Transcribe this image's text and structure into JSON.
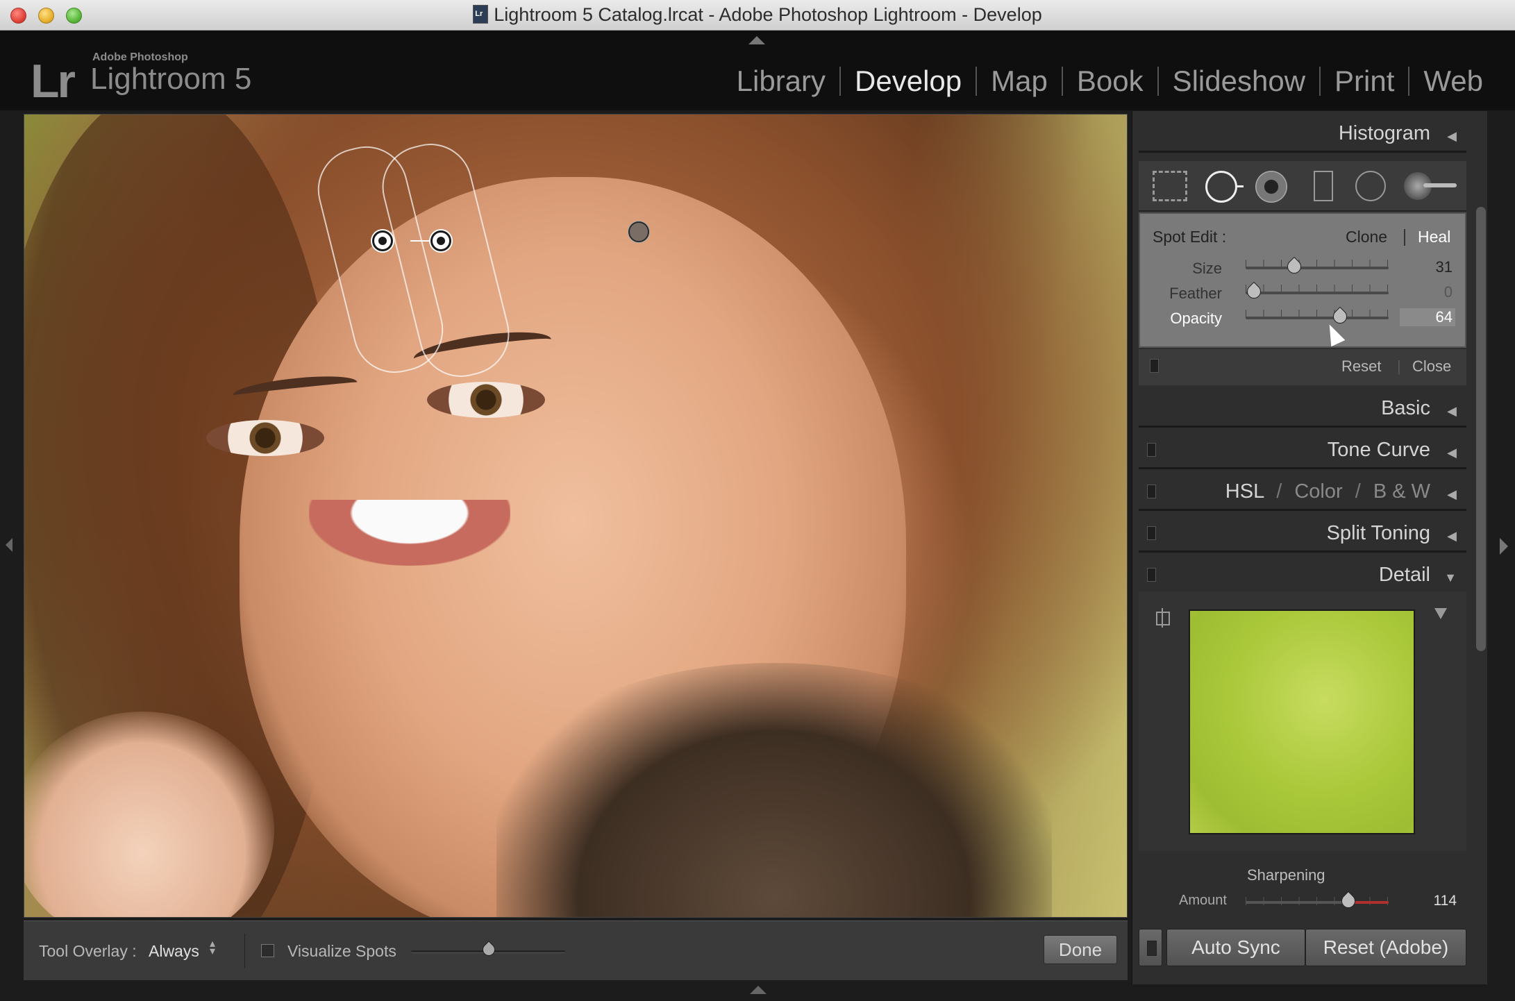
{
  "window": {
    "title": "Lightroom 5 Catalog.lrcat - Adobe Photoshop Lightroom - Develop"
  },
  "brand": {
    "logo": "Lr",
    "small": "Adobe Photoshop",
    "big": "Lightroom 5"
  },
  "modules": [
    {
      "label": "Library"
    },
    {
      "label": "Develop",
      "active": true
    },
    {
      "label": "Map"
    },
    {
      "label": "Book"
    },
    {
      "label": "Slideshow"
    },
    {
      "label": "Print"
    },
    {
      "label": "Web"
    }
  ],
  "toolbar": {
    "overlay_label": "Tool Overlay :",
    "overlay_value": "Always",
    "visualize_label": "Visualize Spots",
    "visualize_level": 0.5,
    "done_label": "Done"
  },
  "panel": {
    "histogram": "Histogram",
    "spot_edit": {
      "label": "Spot Edit :",
      "clone": "Clone",
      "heal": "Heal",
      "size_label": "Size",
      "size_value": "31",
      "feather_label": "Feather",
      "feather_value": "0",
      "opacity_label": "Opacity",
      "opacity_value": "64",
      "reset": "Reset",
      "close": "Close"
    },
    "basic": "Basic",
    "tone_curve": "Tone Curve",
    "hsl": {
      "hsl": "HSL",
      "color": "Color",
      "bw": "B & W",
      "sep": "/"
    },
    "split_toning": "Split Toning",
    "detail": "Detail",
    "sharpening": {
      "title": "Sharpening",
      "amount_label": "Amount",
      "amount_value": "114"
    },
    "auto_sync": "Auto Sync",
    "reset_adobe": "Reset (Adobe)"
  },
  "colors": {
    "accent_active": "#e8e8e8",
    "panel_bg": "#2e2e2e",
    "spot_edit_bg": "#7a7a7a"
  }
}
